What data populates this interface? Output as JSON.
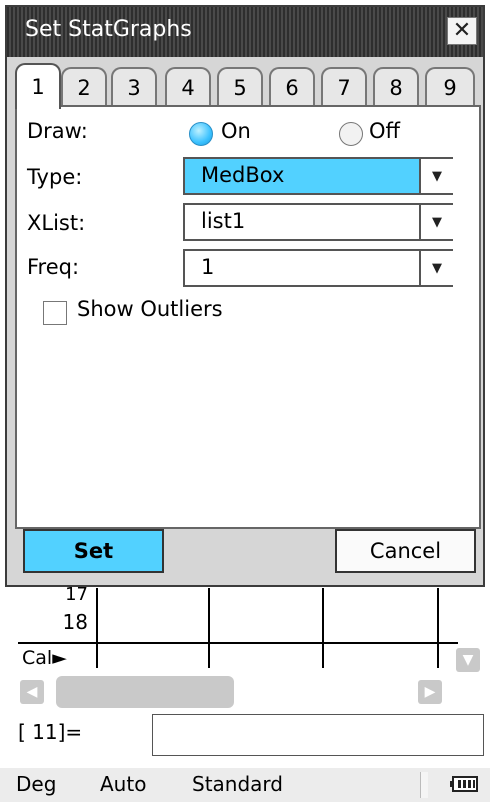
{
  "dialog": {
    "title": "Set StatGraphs",
    "close_symbol": "✕",
    "tabs": [
      "1",
      "2",
      "3",
      "4",
      "5",
      "6",
      "7",
      "8",
      "9"
    ],
    "active_tab": "1",
    "draw": {
      "label": "Draw:",
      "on_label": "On",
      "off_label": "Off",
      "selected": "On"
    },
    "type": {
      "label": "Type:",
      "value": "MedBox"
    },
    "xlist": {
      "label": "XList:",
      "value": "list1"
    },
    "freq": {
      "label": "Freq:",
      "value": "1"
    },
    "show_outliers": {
      "label": "Show Outliers",
      "checked": false
    },
    "set_label": "Set",
    "cancel_label": "Cancel",
    "dropdown_arrow": "▼"
  },
  "spreadsheet": {
    "row_17": "17",
    "row_18": "18",
    "cal_label": "Cal►",
    "cell_ref": "[ 11]=",
    "cell_input": ""
  },
  "status_bar": {
    "angle": "Deg",
    "mode": "Auto",
    "format": "Standard",
    "battery_icon": "battery-icon"
  },
  "colors": {
    "accent": "#52d1ff",
    "titlebar": "#3a3a3a",
    "dialog_bg": "#d6d6d6"
  }
}
